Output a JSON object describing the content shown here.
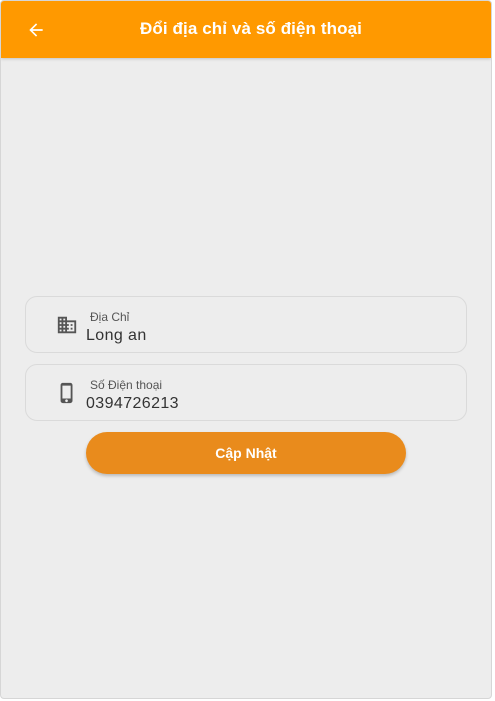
{
  "appbar": {
    "title": "Đổi địa chỉ và số điện thoại",
    "back_icon": "arrow-left-icon",
    "background": "#ff9900"
  },
  "form": {
    "address": {
      "label": "Địa Chỉ",
      "value": "Long an",
      "icon": "building-icon"
    },
    "phone": {
      "label": "Số Điện thoại",
      "value": "0394726213",
      "icon": "smartphone-icon"
    },
    "submit_label": "Cập Nhật",
    "submit_color": "#e98b1c"
  },
  "colors": {
    "background": "#ededed",
    "field_border": "#dadada",
    "icon": "#555555"
  }
}
